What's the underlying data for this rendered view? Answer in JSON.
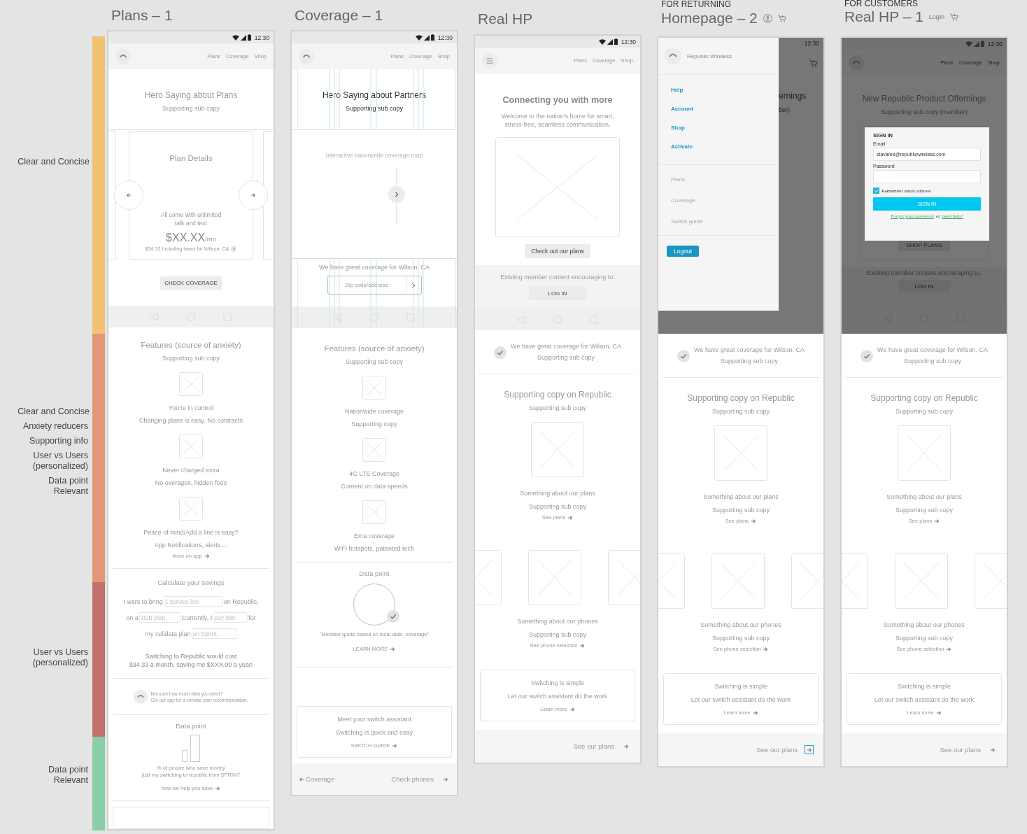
{
  "annotations": [
    {
      "color": "#f0c272",
      "labels": [
        "Clear and Concise"
      ]
    },
    {
      "color": "#e59677",
      "labels": [
        "Clear and Concise",
        "Anxiety reducers",
        "Supporting info",
        "User vs Users\n(personalized)",
        "Data point\nRelevant"
      ]
    },
    {
      "color": "#c4706f",
      "labels": [
        "User vs Users\n(personalized)"
      ]
    },
    {
      "color": "#8ccdaa",
      "labels": [
        "Data point\nRelevant"
      ]
    }
  ],
  "phones": [
    {
      "header": {
        "kind": "plain",
        "title": "Plans – 1"
      },
      "status_time": "12:30",
      "nav": {
        "kind": "logo",
        "links": [
          "Plans",
          "Coverage",
          "Shop"
        ]
      },
      "sections": [
        {
          "kind": "hero",
          "title": "Hero Saying about Plans",
          "subtitle": "Supporting sub copy"
        },
        {
          "kind": "plan-carousel",
          "title": "Plan Details",
          "text": "All come with unlimited\ntalk and text",
          "price": "$XX.XX",
          "unit": "/mo",
          "note": "$34.33 Including taxes for Wilson, CA",
          "help": "?"
        },
        {
          "kind": "button",
          "label": "CHECK COVERAGE"
        },
        {
          "kind": "navbar"
        },
        {
          "kind": "features",
          "title": "Features (source of anxiety)",
          "subtitle": "Supporting sub copy",
          "items": [
            {
              "title": "You're in control",
              "text": "Changing plans is easy. No contracts"
            },
            {
              "title": "Never charged extra",
              "text": "No overages, hidden fees"
            },
            {
              "title": "Peace of mind/Add a line is easy?",
              "text": "App Notifications, alerts....",
              "link": "More on app"
            }
          ]
        },
        {
          "kind": "calculator",
          "title": "Calculate your savings",
          "lines": [
            [
              {
                "kind": "text",
                "text": "I want to bring"
              },
              {
                "kind": "field",
                "placeholder": "1 service line"
              },
              {
                "kind": "text",
                "text": "on Republic,"
              }
            ],
            [
              {
                "kind": "text",
                "text": "on a"
              },
              {
                "kind": "field",
                "placeholder": "3GB plan."
              },
              {
                "kind": "text",
                "text": "Currently, I"
              },
              {
                "kind": "field",
                "placeholder": "pay $80"
              },
              {
                "kind": "text",
                "text": "for"
              }
            ],
            [
              {
                "kind": "text",
                "text": "my celldata plan"
              },
              {
                "kind": "field",
                "placeholder": "on Sprint."
              }
            ]
          ],
          "result": "Switching to Republic would cost\n$34.33 a month, saving me $XXX.00 a year!"
        },
        {
          "kind": "app-promo",
          "text": "Not sure how much data you need?\nGet our app for a concise plan recommendation."
        },
        {
          "kind": "data-bars",
          "title": "Data point",
          "text": "% of people who save money\njust my switching to republic from SPRINT",
          "link": "how we help you save"
        },
        {
          "kind": "card-stub"
        }
      ]
    },
    {
      "header": {
        "kind": "plain",
        "title": "Coverage – 1"
      },
      "status_time": "12:30",
      "nav": {
        "kind": "logo",
        "links": [
          "Plans",
          "Coverage",
          "Shop"
        ]
      },
      "sections": [
        {
          "kind": "hero",
          "title": "Hero Saying about Partners",
          "subtitle": "Supporting sub copy",
          "guides": true
        },
        {
          "kind": "map",
          "label": "Interactive nationwide coverage map"
        },
        {
          "kind": "zip",
          "text": "We have great coverage for Wilson, CA",
          "placeholder": "Zip code/address",
          "guides": true
        },
        {
          "kind": "navbar",
          "guides": true
        },
        {
          "kind": "features",
          "title": "Features (source of anxiety)",
          "subtitle": "Supporting sub copy",
          "items": [
            {
              "title": "Nationwide coverage",
              "text": "Supporting copy"
            },
            {
              "title": "4G LTE Coverage",
              "text": "Content on data speeds"
            },
            {
              "title": "Exra coverage",
              "text": "WiFi hotspots, patented tech"
            }
          ]
        },
        {
          "kind": "data-quote",
          "title": "Data point",
          "quote": "\"Member quote based on local data- coverage\"",
          "link": "LEARN MORE"
        },
        {
          "kind": "spacer"
        },
        {
          "kind": "card",
          "lines": [
            "Meet your switch assistant",
            "Switching is quick and easy"
          ],
          "link": "SWITCH GUIDE"
        },
        {
          "kind": "footer",
          "back": "Coverage",
          "next": "Check phones",
          "focused": false
        }
      ]
    },
    {
      "header": {
        "kind": "plain",
        "title": "Real HP"
      },
      "status_time": "12:30",
      "nav": {
        "kind": "menu",
        "links": [
          "Plans",
          "Coverage",
          "Shop"
        ]
      },
      "sections": [
        {
          "kind": "intro",
          "title": "Connecting you with more",
          "text": "Welcome to the nation's home for smart,\nstress-free, seamless communication.",
          "button": "Check out our plans"
        },
        {
          "kind": "member",
          "text": "Existing member content encouraging to:",
          "button": "LOG IN"
        },
        {
          "kind": "navbar"
        },
        {
          "kind": "check-row",
          "text": "We have great coverage for Wilson, CA",
          "subtitle": "Supporting sub copy"
        },
        {
          "kind": "promo",
          "title": "Supporting copy on Republic",
          "subtitle": "Supporting sub copy",
          "item_title": "Something about our plans",
          "item_text": "Supporting sub copy",
          "link": "See plans"
        },
        {
          "kind": "phones",
          "title": "Something about our phones",
          "text": "Supporting sub copy",
          "link": "See phone selection"
        },
        {
          "kind": "card",
          "lines": [
            "Switching is simple",
            "Let our switch assistant do the work"
          ],
          "link": "Learn more"
        },
        {
          "kind": "footer",
          "next": "See our plans",
          "focused": false
        }
      ]
    },
    {
      "header": {
        "kind": "annotated",
        "eyebrow": "FOR RETURNING",
        "title": "Homepage – 2"
      },
      "sections": [
        {
          "kind": "drawer",
          "brand": "Republic Wireless",
          "primary": [
            "Help",
            "Account",
            "Shop",
            "Activate"
          ],
          "secondary": [
            "Plans",
            "Coverage",
            "Switch guide"
          ],
          "button": "Logout",
          "time": "12:30",
          "peek": [
            "ernings",
            "ber)"
          ]
        },
        {
          "kind": "check-row",
          "text": "We have great coverage for Wilson, CA",
          "subtitle": "Supporting sub copy"
        },
        {
          "kind": "promo",
          "title": "Supporting copy on Republic",
          "subtitle": "Supporting sub copy",
          "item_title": "Something about our plans",
          "item_text": "Supporting sub copy",
          "link": "See plans"
        },
        {
          "kind": "phones",
          "title": "Something about our phones",
          "text": "Supporting sub copy",
          "link": "See phone selection"
        },
        {
          "kind": "card",
          "lines": [
            "Switching is simple",
            "Let our switch assistant do the work"
          ],
          "link": "Learn more"
        },
        {
          "kind": "footer",
          "next": "See our plans",
          "focused": true
        }
      ]
    },
    {
      "header": {
        "kind": "annotated",
        "eyebrow": "FOR CUSTOMERS",
        "title": "Real HP – 1",
        "note": "Login"
      },
      "sections": [
        {
          "kind": "dimmed",
          "time": "12:30",
          "links": [
            "Plans",
            "Coverage",
            "Shop"
          ],
          "title": "New Republic Product Offernings",
          "subtitle": "Supporting sub copy (member)",
          "button": "SHOP PLANS",
          "member_text": "Existing member content encouraging to:",
          "member_button": "LOG IN",
          "modal": {
            "title": "SIGN IN",
            "email_label": "Email",
            "email": "stavares@republicwireless.com",
            "password_label": "Password",
            "remember": "Remember email address",
            "remember_checked": true,
            "button": "SIGN IN",
            "forgot": "Forgot your password",
            "or": "or",
            "help": "need help?"
          }
        },
        {
          "kind": "check-row",
          "text": "We have great coverage for Wilson, CA",
          "subtitle": "Supporting sub copy"
        },
        {
          "kind": "promo",
          "title": "Supporting copy on Republic",
          "subtitle": "Supporting sub copy",
          "item_title": "Something about our plans",
          "item_text": "Supporting sub copy",
          "link": "See plans"
        },
        {
          "kind": "phones",
          "title": "Something about our phones",
          "text": "Supporting sub copy",
          "link": "See phone selection"
        },
        {
          "kind": "card",
          "lines": [
            "Switching is simple",
            "Let our switch assistant do the work"
          ],
          "link": "Learn more"
        },
        {
          "kind": "footer",
          "next": "See our plans",
          "focused": false
        }
      ]
    }
  ]
}
